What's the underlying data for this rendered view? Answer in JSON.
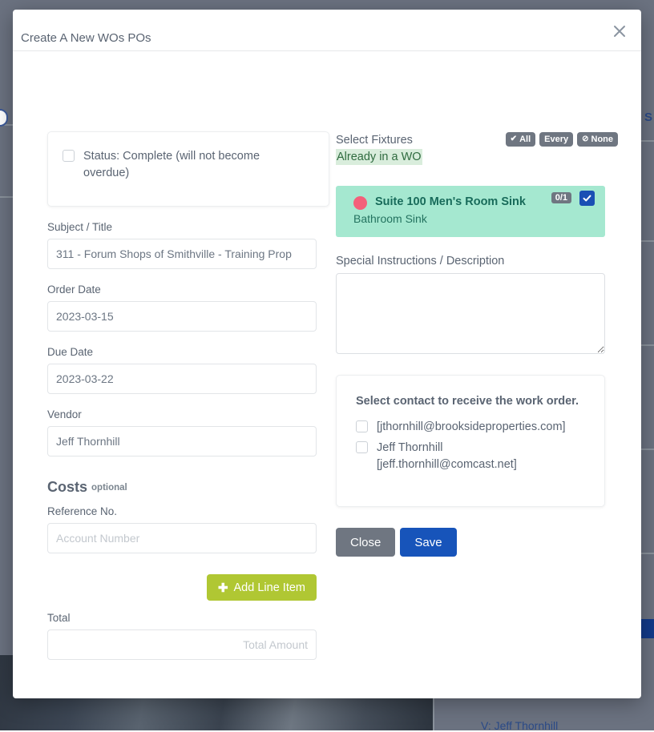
{
  "modal": {
    "title": "Create A New WOs POs",
    "close_icon": "close-icon"
  },
  "left": {
    "status": {
      "label": "Status: Complete (will not become overdue)",
      "checked": false
    },
    "subject": {
      "label": "Subject / Title",
      "value": "311 - Forum Shops of Smithville - Training Prop",
      "placeholder": ""
    },
    "order_date": {
      "label": "Order Date",
      "value": "2023-03-15",
      "placeholder": ""
    },
    "due_date": {
      "label": "Due Date",
      "value": "2023-03-22",
      "placeholder": ""
    },
    "vendor": {
      "label": "Vendor",
      "value": "Jeff Thornhill",
      "placeholder": ""
    },
    "costs": {
      "heading": "Costs",
      "optional": "optional",
      "reference_label": "Reference No.",
      "reference_value": "",
      "reference_placeholder": "Account Number",
      "add_line_item_label": "Add Line Item",
      "add_line_item_icon": "plus-icon",
      "add_line_item_color": "#b0c733",
      "total_label": "Total",
      "total_value": "",
      "total_placeholder": "Total Amount"
    }
  },
  "right": {
    "fixtures": {
      "label": "Select Fixtures",
      "already_in_wo": "Already in a WO",
      "already_in_wo_bg": "#d9eddc",
      "already_in_wo_fg": "#2f6b3f",
      "filters": [
        {
          "label": "All",
          "icon": "check-icon"
        },
        {
          "label": "Every",
          "icon": ""
        },
        {
          "label": "None",
          "icon": "ban-icon"
        }
      ],
      "items": [
        {
          "name": "Suite 100 Men's Room Sink",
          "type": "Bathroom Sink",
          "count": "0/1",
          "dot_color": "#f4607a",
          "card_color": "#a5e8d0",
          "checked": true
        }
      ]
    },
    "instructions": {
      "label": "Special Instructions / Description",
      "value": "",
      "placeholder": ""
    },
    "contacts": {
      "title": "Select contact to receive the work order.",
      "items": [
        {
          "label": "[jthornhill@brooksideproperties.com]",
          "checked": false
        },
        {
          "label": "Jeff Thornhill [jeff.thornhill@comcast.net]",
          "checked": false
        }
      ]
    },
    "actions": {
      "close_label": "Close",
      "close_color": "#6f7681",
      "save_label": "Save",
      "save_color": "#1754ba"
    }
  },
  "background": {
    "right_letter": "S",
    "bottom_text": "V: Jeff Thornhill",
    "overlay_color": "#6b7280"
  }
}
